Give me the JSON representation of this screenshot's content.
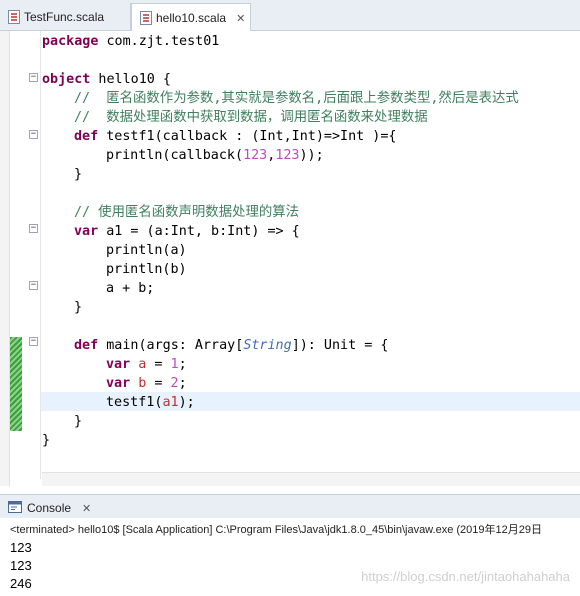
{
  "tabs": [
    {
      "label": "TestFunc.scala",
      "active": false
    },
    {
      "label": "hello10.scala",
      "active": true
    }
  ],
  "editor": {
    "package_kw": "package",
    "package_name": " com.zjt.test01",
    "object_kw": "object",
    "object_name": " hello10 {",
    "comment1": "//  匿名函数作为参数,其实就是参数名,后面跟上参数类型,然后是表达式",
    "comment2": "//  数据处理函数中获取到数据，调用匿名函数来处理数据",
    "def_kw": "def",
    "testf1_sig": " testf1(callback : (Int,Int)=>Int )={",
    "println_open": "println(callback(",
    "num123a": "123",
    "comma": ",",
    "num123b": "123",
    "println_close": "));",
    "close_brace": "}",
    "comment3": "// 使用匿名函数声明数据处理的算法",
    "var_kw": "var",
    "a1_decl": " a1 = (a:Int, b:Int) => {",
    "println_a": "println(a)",
    "println_b": "println(b)",
    "a_plus_b": "a + b;",
    "main_sig_1": " main(args: Array[",
    "main_sig_string": "String",
    "main_sig_2": "]): Unit = {",
    "var_a_name": "a",
    "var_a_eq": " = ",
    "var_a_val": "1",
    "semicolon": ";",
    "var_b_name": "b",
    "var_b_val": "2",
    "call_open": "testf1(",
    "call_arg": "a1",
    "call_close": ");",
    "obj_close": "}"
  },
  "console": {
    "tab_label": "Console",
    "status": "<terminated> hello10$ [Scala Application] C:\\Program Files\\Java\\jdk1.8.0_45\\bin\\javaw.exe (2019年12月29日",
    "output": [
      "123",
      "123",
      "246"
    ],
    "watermark": "https://blog.csdn.net/jintaohahahaha"
  },
  "colors": {
    "keyword": "#7f0055",
    "comment": "#3f7f5f",
    "number": "#c04ac0",
    "type": "#3f6fb0",
    "local_var": "#c03030",
    "current_line": "#e8f2fe"
  },
  "icons": [
    "scala-file-icon",
    "close-icon",
    "console-icon",
    "fold-collapse-icon"
  ]
}
